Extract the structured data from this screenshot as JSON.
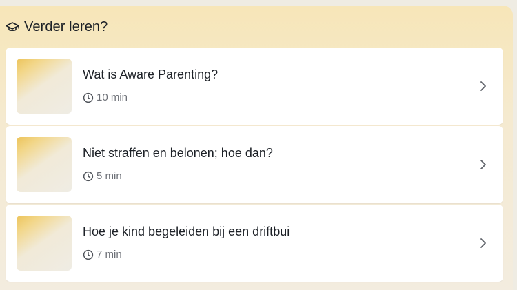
{
  "section": {
    "title": "Verder leren?",
    "icon": "graduation-cap-icon"
  },
  "items": [
    {
      "title": "Wat is Aware Parenting?",
      "duration": "10 min"
    },
    {
      "title": "Niet straffen en belonen; hoe dan?",
      "duration": "5 min"
    },
    {
      "title": "Hoe je kind begeleiden bij een driftbui",
      "duration": "7 min"
    }
  ],
  "colors": {
    "panel_gradient_top": "#f7e6b8",
    "panel_gradient_bottom": "#f3ecdf",
    "accent": "#ecc35a",
    "text": "#1d2127",
    "muted": "#6d7077"
  }
}
